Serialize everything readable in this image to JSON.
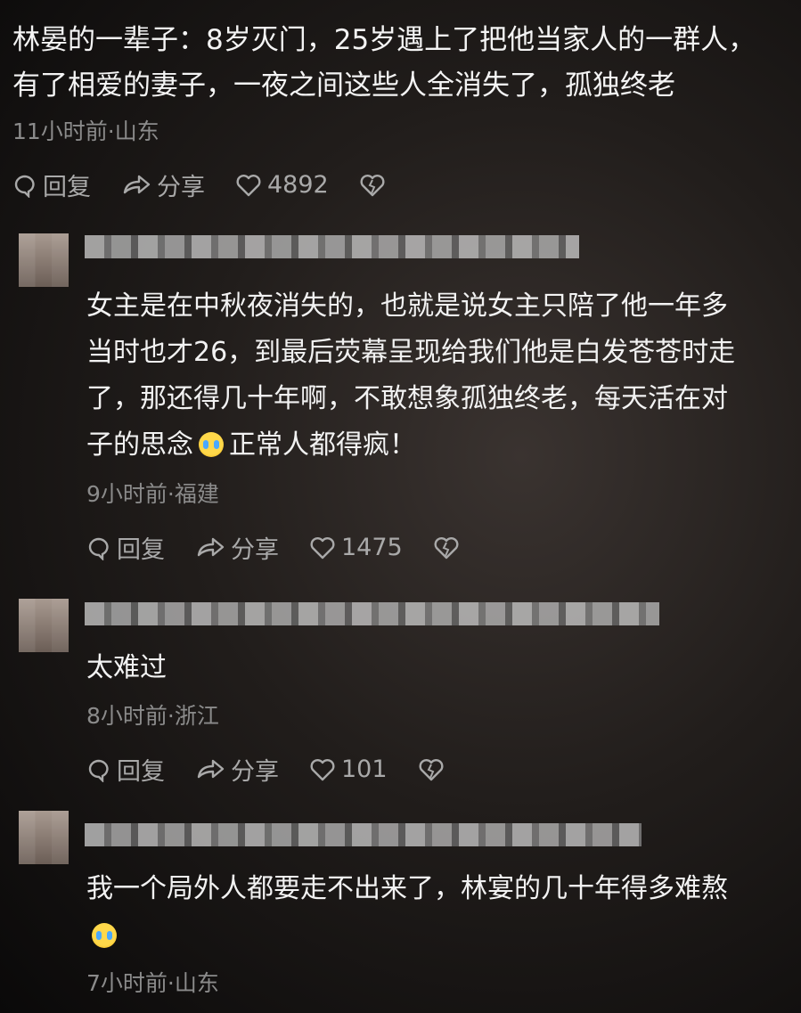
{
  "post": {
    "text": "林晏的一辈子：8岁灭门，25岁遇上了把他当家人的一群人，\n有了相爱的妻子，一夜之间这些人全消失了，孤独终老",
    "meta": "11小时前·山东",
    "reply_label": "回复",
    "share_label": "分享",
    "likes": "4892"
  },
  "comments": [
    {
      "text_a": "女主是在中秋夜消失的，也就是说女主只陪了他一年多\n当时也才26，到最后荧幕呈现给我们他是白发苍苍时走\n了，那还得几十年啊，不敢想象孤独终老，每天活在对\n子的思念",
      "text_b": "正常人都得疯！",
      "meta": "9小时前·福建",
      "reply_label": "回复",
      "share_label": "分享",
      "likes": "1475"
    },
    {
      "text": "太难过",
      "meta": "8小时前·浙江",
      "reply_label": "回复",
      "share_label": "分享",
      "likes": "101"
    },
    {
      "text": "我一个局外人都要走不出来了，林宴的几十年得多难熬",
      "meta": "7小时前·山东"
    }
  ],
  "icons": {
    "reply": "reply-bubble-icon",
    "share": "share-arrow-icon",
    "like": "heart-icon",
    "dislike": "broken-heart-icon",
    "emoji": "crying-face-emoji"
  }
}
